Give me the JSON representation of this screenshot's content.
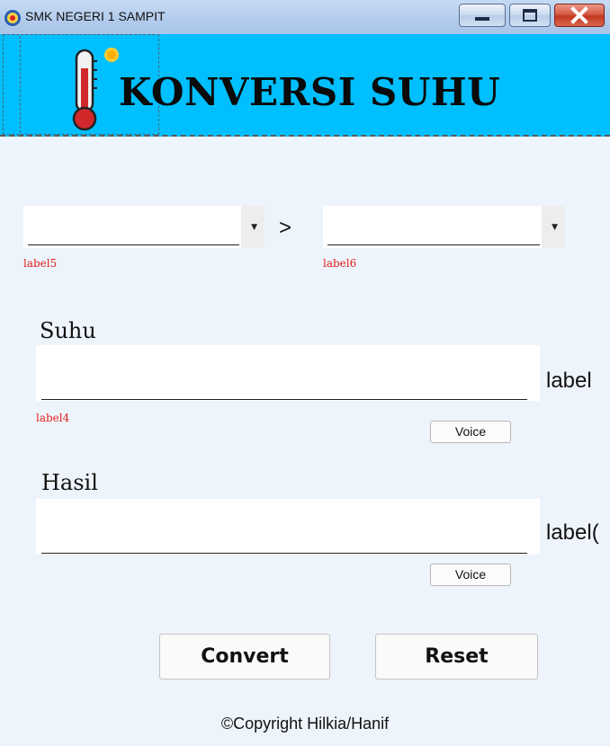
{
  "window": {
    "title": "SMK NEGERI 1 SAMPIT"
  },
  "banner": {
    "title": "KONVERSI SUHU"
  },
  "converter": {
    "from_label": "label5",
    "to_label": "label6",
    "separator": ">"
  },
  "suhu": {
    "label": "Suhu",
    "value": "",
    "unit_label": "label",
    "status_label": "label4",
    "voice_label": "Voice"
  },
  "hasil": {
    "label": "Hasil",
    "value": "",
    "unit_label": "label(",
    "voice_label": "Voice"
  },
  "actions": {
    "convert_label": "Convert",
    "reset_label": "Reset"
  },
  "footer": {
    "copyright": "©Copyright Hilkia/Hanif"
  },
  "colors": {
    "banner": "#00bfff",
    "background": "#eef4fb",
    "status_text": "#e0201e"
  }
}
